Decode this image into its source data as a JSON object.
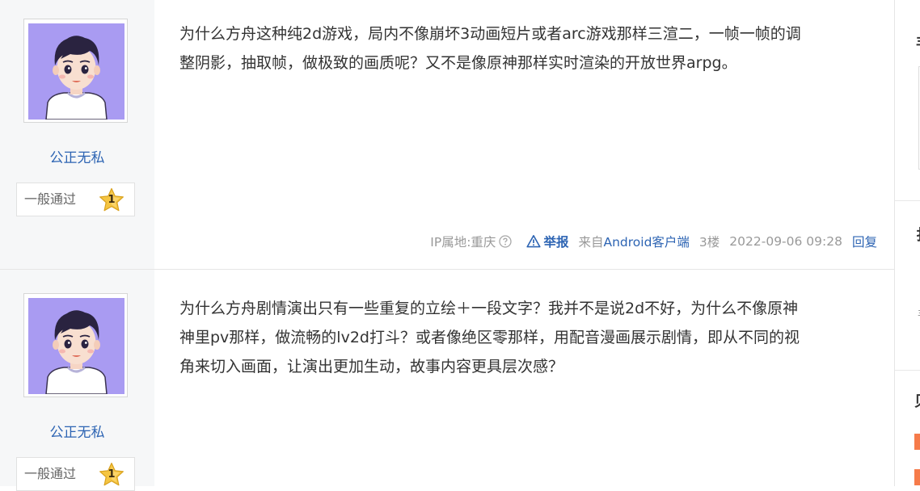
{
  "posts": [
    {
      "author": {
        "name": "公正无私",
        "level_name": "一般通过",
        "level": "1"
      },
      "content": "为什么方舟这种纯2d游戏，局内不像崩坏3动画短片或者arc游戏那样三渲二，一帧一帧的调\n整阴影，抽取帧，做极致的画质呢？又不是像原神那样实时渲染的开放世界arpg。",
      "tail": {
        "ip": "IP属地:重庆",
        "report": "举报",
        "source_prefix": "来自",
        "client": "Android客户端",
        "floor": "3楼",
        "time": "2022-09-06 09:28",
        "reply": "回复"
      }
    },
    {
      "author": {
        "name": "公正无私",
        "level_name": "一般通过",
        "level": "1"
      },
      "content": "为什么方舟剧情演出只有一些重复的立绘＋一段文字？我并不是说2d不好，为什么不像原神\n神里pv那样，做流畅的lv2d打斗？或者像绝区零那样，用配音漫画展示剧情，即从不同的视\n角来切入画面，让演出更加生动，故事内容更具层次感？"
    }
  ],
  "sidebar": {
    "fragments": [
      "丰",
      "扌",
      "丰",
      "贝"
    ]
  },
  "colors": {
    "link": "#2d64b3",
    "meta": "#999999",
    "text": "#333333",
    "author_bg": "#f6f7f8",
    "avatar_bg": "#a99bf2",
    "badge": "#f5c542",
    "accent": "#f67b4a"
  },
  "icons": {
    "help": "question-circle-icon",
    "report": "warning-triangle-icon",
    "badge": "star-badge-icon"
  }
}
